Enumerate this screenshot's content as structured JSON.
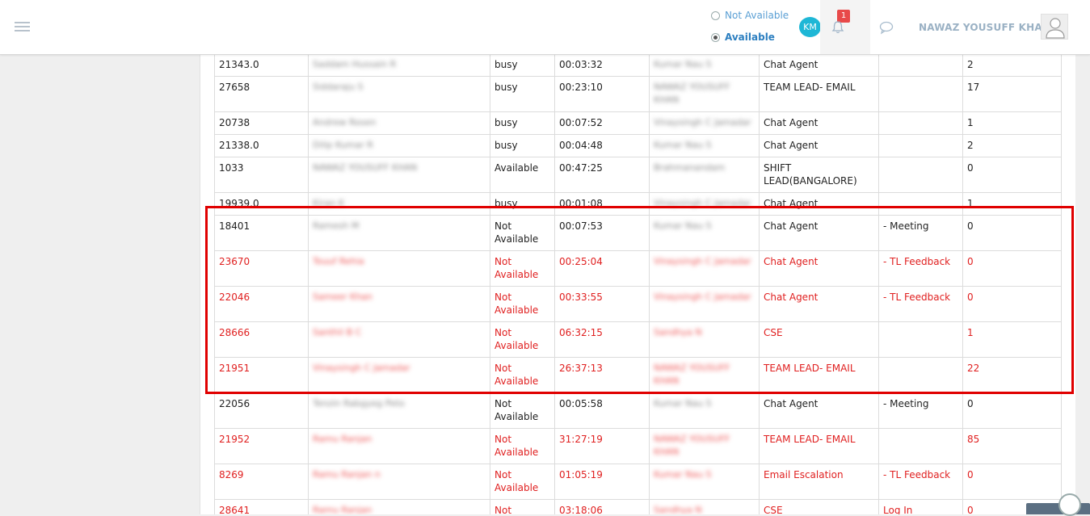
{
  "header": {
    "status_not_available": "Not Available",
    "status_available": "Available",
    "km_initials": "KM",
    "notification_count": "1",
    "user_name": "NAWAZ YOUSUFF KHAN"
  },
  "colors": {
    "accent": "#1eb7d6",
    "alert": "#e02020",
    "badge": "#e84a4a"
  },
  "table": {
    "rows": [
      {
        "id": "21343.0",
        "name": "Saddam Hussain R",
        "status": "busy",
        "time": "00:03:32",
        "tl": "Kumar Nau S",
        "role": "Chat Agent",
        "reason": "",
        "count": "2",
        "red": false
      },
      {
        "id": "27658",
        "name": "Siddaraju S",
        "status": "busy",
        "time": "00:23:10",
        "tl": "NAWAZ YOUSUFF KHAN",
        "role": "TEAM LEAD- EMAIL",
        "reason": "",
        "count": "17",
        "red": false
      },
      {
        "id": "20738",
        "name": "Andrew Rosen",
        "status": "busy",
        "time": "00:07:52",
        "tl": "Vinaysingh C Jamadar",
        "role": "Chat Agent",
        "reason": "",
        "count": "1",
        "red": false
      },
      {
        "id": "21338.0",
        "name": "Dilip Kumar R",
        "status": "busy",
        "time": "00:04:48",
        "tl": "Kumar Nau S",
        "role": "Chat Agent",
        "reason": "",
        "count": "2",
        "red": false
      },
      {
        "id": "1033",
        "name": "NAWAZ YOUSUFF KHAN",
        "status": "Available",
        "time": "00:47:25",
        "tl": "Brahmanandam",
        "role": "SHIFT LEAD(BANGALORE)",
        "reason": "",
        "count": "0",
        "red": false
      },
      {
        "id": "19939.0",
        "name": "Kiran K",
        "status": "busy",
        "time": "00:01:08",
        "tl": "Vinaysingh C Jamadar",
        "role": "Chat Agent",
        "reason": "",
        "count": "1",
        "red": false
      },
      {
        "id": "18401",
        "name": "Ramesh M",
        "status": "Not Available",
        "time": "00:07:53",
        "tl": "Kumar Nau S",
        "role": "Chat Agent",
        "reason": "- Meeting",
        "count": "0",
        "red": false
      },
      {
        "id": "23670",
        "name": "Touuf Rehia",
        "status": "Not Available",
        "time": "00:25:04",
        "tl": "Vinaysingh C Jamadar",
        "role": "Chat Agent",
        "reason": "- TL Feedback",
        "count": "0",
        "red": true
      },
      {
        "id": "22046",
        "name": "Sameer Khan",
        "status": "Not Available",
        "time": "00:33:55",
        "tl": "Vinaysingh C Jamadar",
        "role": "Chat Agent",
        "reason": "- TL Feedback",
        "count": "0",
        "red": true
      },
      {
        "id": "28666",
        "name": "Santhil B C",
        "status": "Not Available",
        "time": "06:32:15",
        "tl": "Sandhya N",
        "role": "CSE",
        "reason": "",
        "count": "1",
        "red": true
      },
      {
        "id": "21951",
        "name": "Vinaysingh C Jamadar",
        "status": "Not Available",
        "time": "26:37:13",
        "tl": "NAWAZ YOUSUFF KHAN",
        "role": "TEAM LEAD- EMAIL",
        "reason": "",
        "count": "22",
        "red": true
      },
      {
        "id": "22056",
        "name": "Tenzin Rabgyeg Peto",
        "status": "Not Available",
        "time": "00:05:58",
        "tl": "Kumar Nau S",
        "role": "Chat Agent",
        "reason": "- Meeting",
        "count": "0",
        "red": false
      },
      {
        "id": "21952",
        "name": "Ramu Ranjan",
        "status": "Not Available",
        "time": "31:27:19",
        "tl": "NAWAZ YOUSUFF KHAN",
        "role": "TEAM LEAD- EMAIL",
        "reason": "",
        "count": "85",
        "red": true
      },
      {
        "id": "8269",
        "name": "Ramu Ranjan n",
        "status": "Not Available",
        "time": "01:05:19",
        "tl": "Kumar Nau S",
        "role": "Email Escalation",
        "reason": "- TL Feedback",
        "count": "0",
        "red": true
      },
      {
        "id": "28641",
        "name": "Ramu Ranjan",
        "status": "Not",
        "time": "03:18:06",
        "tl": "Sandhya N",
        "role": "CSE",
        "reason": "Log In",
        "count": "0",
        "red": true
      }
    ]
  }
}
